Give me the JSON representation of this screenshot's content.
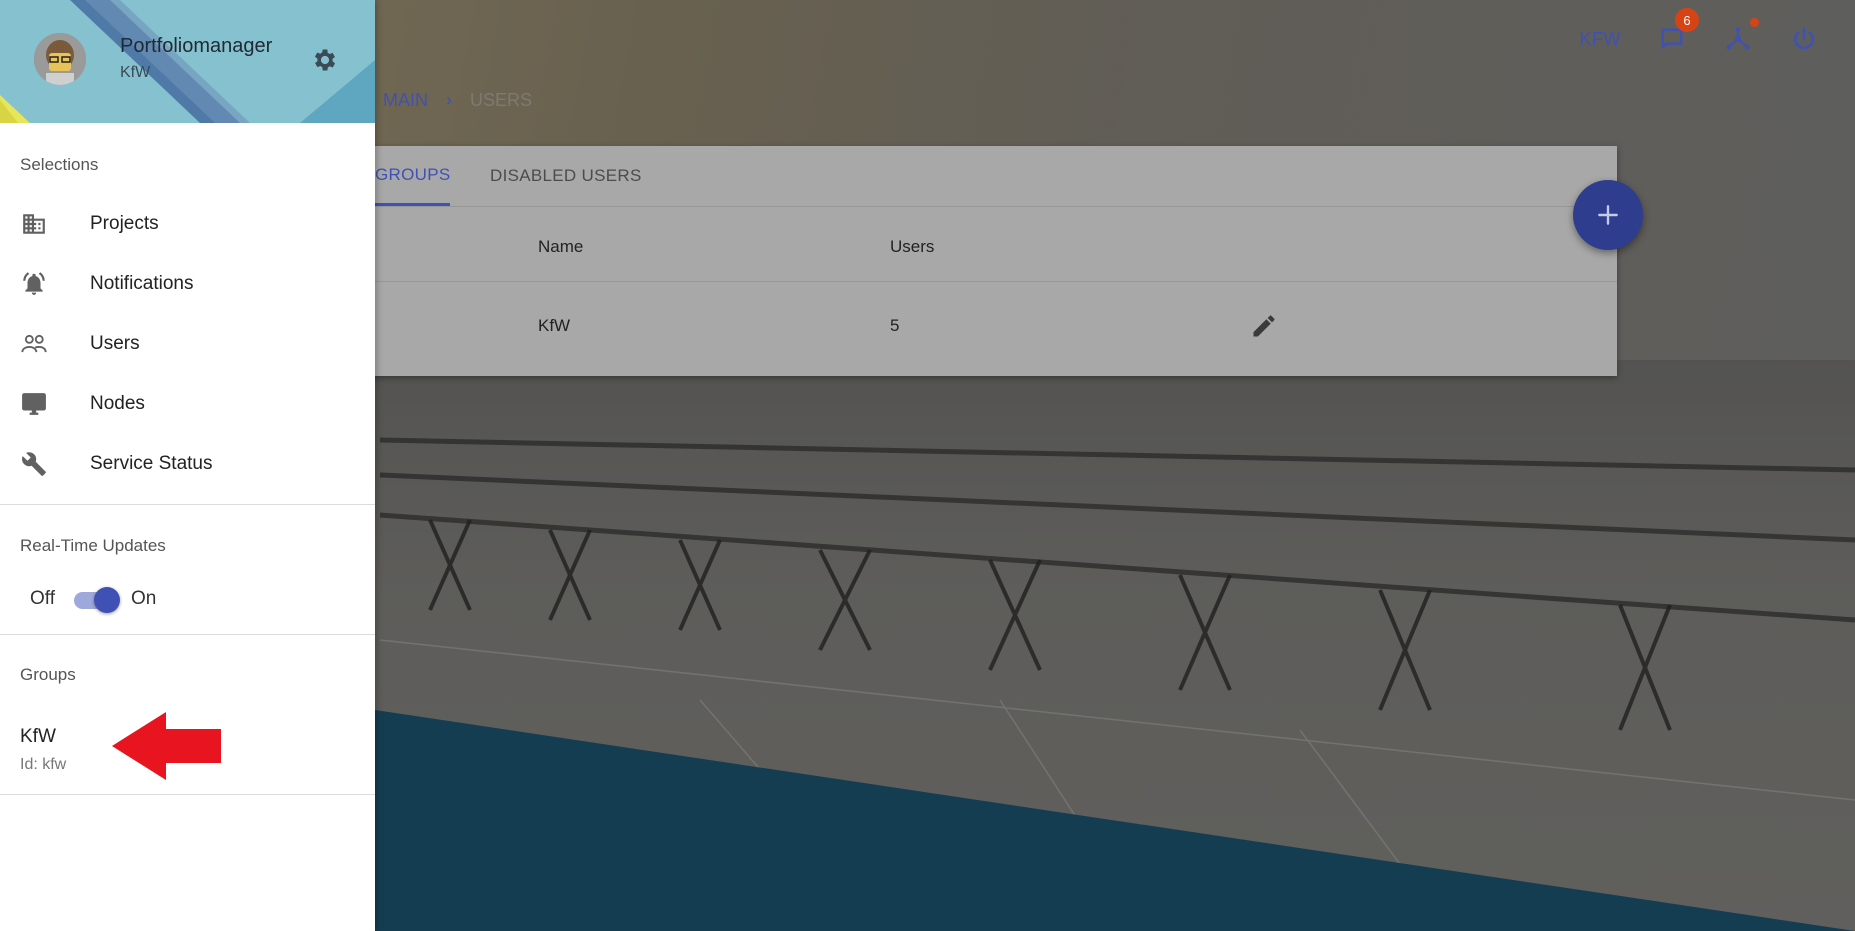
{
  "drawer": {
    "header": {
      "user_name": "Portfoliomanager",
      "organization": "KfW"
    },
    "selections_label": "Selections",
    "nav_items": [
      {
        "label": "Projects",
        "icon": "building-icon"
      },
      {
        "label": "Notifications",
        "icon": "notification-bell-icon"
      },
      {
        "label": "Users",
        "icon": "people-icon"
      },
      {
        "label": "Nodes",
        "icon": "monitor-icon"
      },
      {
        "label": "Service Status",
        "icon": "wrench-icon"
      }
    ],
    "realtime": {
      "label": "Real-Time Updates",
      "off_label": "Off",
      "on_label": "On",
      "state": "on"
    },
    "groups": {
      "label": "Groups",
      "items": [
        {
          "name": "KfW",
          "id_text": "Id: kfw"
        }
      ]
    }
  },
  "topbar": {
    "org_label": "KFW",
    "messages_badge": "6"
  },
  "breadcrumb": {
    "main": "MAIN",
    "separator": "›",
    "current": "USERS"
  },
  "card": {
    "tabs": [
      {
        "label": "GROUPS",
        "active": true
      },
      {
        "label": "DISABLED USERS",
        "active": false
      }
    ],
    "columns": {
      "name": "Name",
      "users": "Users"
    },
    "rows": [
      {
        "name": "KfW",
        "users": "5"
      }
    ]
  },
  "fab": {
    "label": "+"
  },
  "colors": {
    "primary": "#3f51b5",
    "badge": "#d84315",
    "annotation_arrow": "#e8141f"
  }
}
